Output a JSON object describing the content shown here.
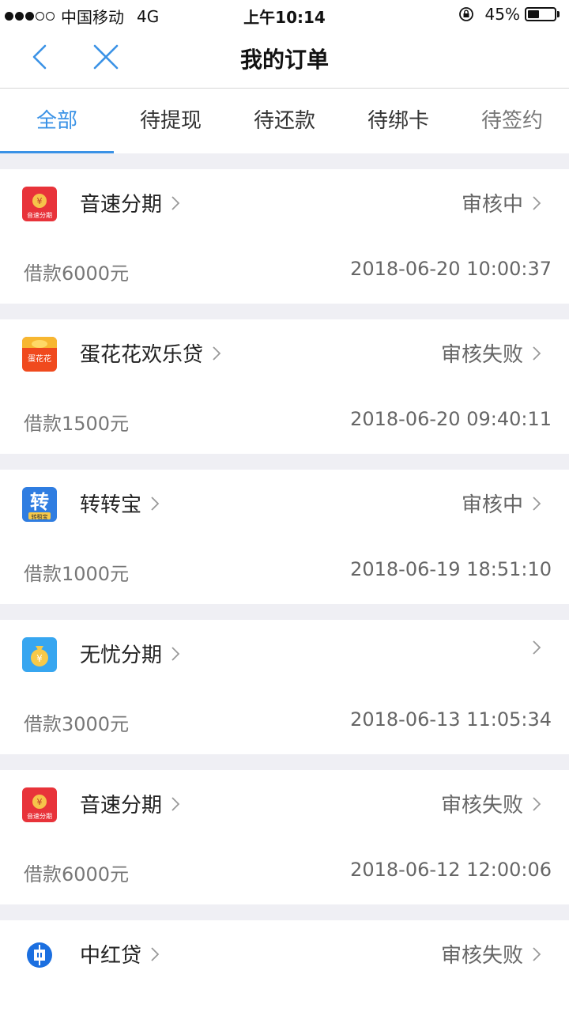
{
  "status_bar": {
    "carrier": "中国移动",
    "network": "4G",
    "time": "上午10:14",
    "battery_text": "45%",
    "battery_level": 0.45,
    "signal_filled": 3,
    "signal_total": 5
  },
  "nav": {
    "title": "我的订单"
  },
  "tabs": [
    {
      "label": "全部"
    },
    {
      "label": "待提现"
    },
    {
      "label": "待还款"
    },
    {
      "label": "待绑卡"
    },
    {
      "label": "待签约"
    }
  ],
  "orders": [
    {
      "name": "音速分期",
      "status": "审核中",
      "amount": "借款6000元",
      "date": "2018-06-20 10:00:37",
      "logo_text": "音速分期",
      "logo_symbol": "¥",
      "logo_color": "#e8333a"
    },
    {
      "name": "蛋花花欢乐贷",
      "status": "审核失败",
      "amount": "借款1500元",
      "date": "2018-06-20 09:40:11",
      "logo_text": "蛋花花",
      "logo_color": "#f04a1e"
    },
    {
      "name": "转转宝",
      "status": "审核中",
      "amount": "借款1000元",
      "date": "2018-06-19 18:51:10",
      "logo_text": "转",
      "logo_sub": "转租宝",
      "logo_color": "#2f7de1"
    },
    {
      "name": "无忧分期",
      "status": "",
      "amount": "借款3000元",
      "date": "2018-06-13 11:05:34",
      "logo_symbol": "¥",
      "logo_color": "#37a6f0"
    },
    {
      "name": "音速分期",
      "status": "审核失败",
      "amount": "借款6000元",
      "date": "2018-06-12 12:00:06",
      "logo_text": "音速分期",
      "logo_symbol": "¥",
      "logo_color": "#e8333a"
    },
    {
      "name": "中红贷",
      "status": "审核失败",
      "amount": "",
      "date": "",
      "logo_color": "#1b6fe0"
    }
  ]
}
